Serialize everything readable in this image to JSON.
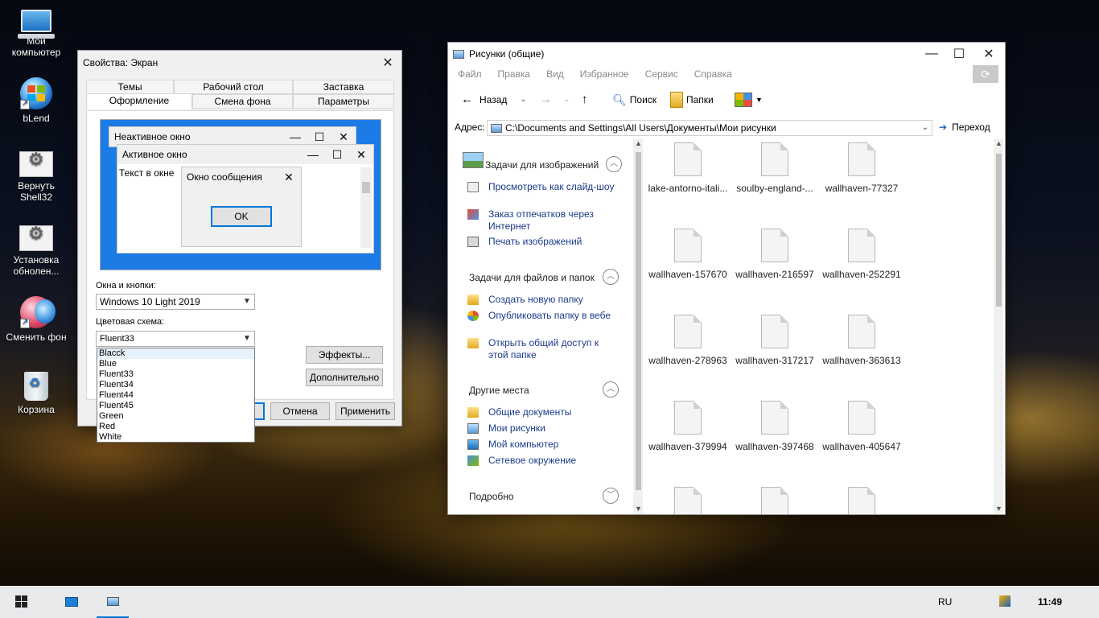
{
  "desktop": {
    "icons": [
      {
        "label_line1": "Мой",
        "label_line2": "компьютер",
        "icon": "my-computer-icon"
      },
      {
        "label_line1": "bLend",
        "label_line2": "",
        "icon": "blend-icon"
      },
      {
        "label_line1": "Вернуть",
        "label_line2": "Shell32",
        "icon": "restore-shell32-icon"
      },
      {
        "label_line1": "Установка",
        "label_line2": "обнолен...",
        "icon": "install-update-icon"
      },
      {
        "label_line1": "Сменить фон",
        "label_line2": "",
        "icon": "change-wallpaper-icon"
      },
      {
        "label_line1": "Корзина",
        "label_line2": "",
        "icon": "recycle-bin-icon"
      }
    ]
  },
  "display_dialog": {
    "title": "Свойства: Экран",
    "close_glyph": "✕",
    "tabs_row1": [
      "Темы",
      "Рабочий стол",
      "Заставка"
    ],
    "tabs_row2": [
      "Оформление",
      "Смена фона",
      "Параметры"
    ],
    "preview": {
      "inactive_title": "Неактивное окно",
      "active_title": "Активное окно",
      "window_text": "Текст в окне",
      "message_title": "Окно сообщения",
      "ok": "OK"
    },
    "windows_buttons_label": "Окна и кнопки:",
    "windows_buttons_value": "Windows 10 Light 2019",
    "color_scheme_label": "Цветовая схема:",
    "color_scheme_value": "Fluent33",
    "color_scheme_options": [
      "Blacck",
      "Blue",
      "Fluent33",
      "Fluent34",
      "Fluent44",
      "Fluent45",
      "Green",
      "Red",
      "White"
    ],
    "effects_button": "Эффекты...",
    "advanced_button": "Дополнительно",
    "ok_button": "OK",
    "cancel_button": "Отмена",
    "apply_button": "Применить"
  },
  "explorer": {
    "title": "Рисунки (общие)",
    "menu": [
      "Файл",
      "Правка",
      "Вид",
      "Избранное",
      "Сервис",
      "Справка"
    ],
    "toolbar": {
      "back": "Назад",
      "search": "Поиск",
      "folders": "Папки"
    },
    "address_label": "Адрес:",
    "address_value": "C:\\Documents and Settings\\All Users\\Документы\\Мои рисунки",
    "go_button": "Переход",
    "sections": {
      "image_tasks": {
        "title": "Задачи для изображений",
        "items": [
          "Просмотреть как слайд-шоу",
          "Заказ отпечатков через Интернет",
          "Печать изображений"
        ]
      },
      "file_tasks": {
        "title": "Задачи для файлов и папок",
        "items": [
          "Создать новую папку",
          "Опубликовать папку в вебе",
          "Открыть общий доступ к этой папке"
        ]
      },
      "other_places": {
        "title": "Другие места",
        "items": [
          "Общие документы",
          "Мои рисунки",
          "Мой компьютер",
          "Сетевое окружение"
        ]
      },
      "details": {
        "title": "Подробно"
      }
    },
    "files": [
      "lake-antorno-itali...",
      "soulby-england-...",
      "wallhaven-77327",
      "wallhaven-157670",
      "wallhaven-216597",
      "wallhaven-252291",
      "wallhaven-278963",
      "wallhaven-317217",
      "wallhaven-363613",
      "wallhaven-379994",
      "wallhaven-397468",
      "wallhaven-405647",
      "",
      "",
      ""
    ]
  },
  "taskbar": {
    "language": "RU",
    "time": "11:49"
  },
  "colors": {
    "accent": "#0078d7",
    "preview_desktop": "#1d7be6",
    "link": "#1a3a8a"
  }
}
